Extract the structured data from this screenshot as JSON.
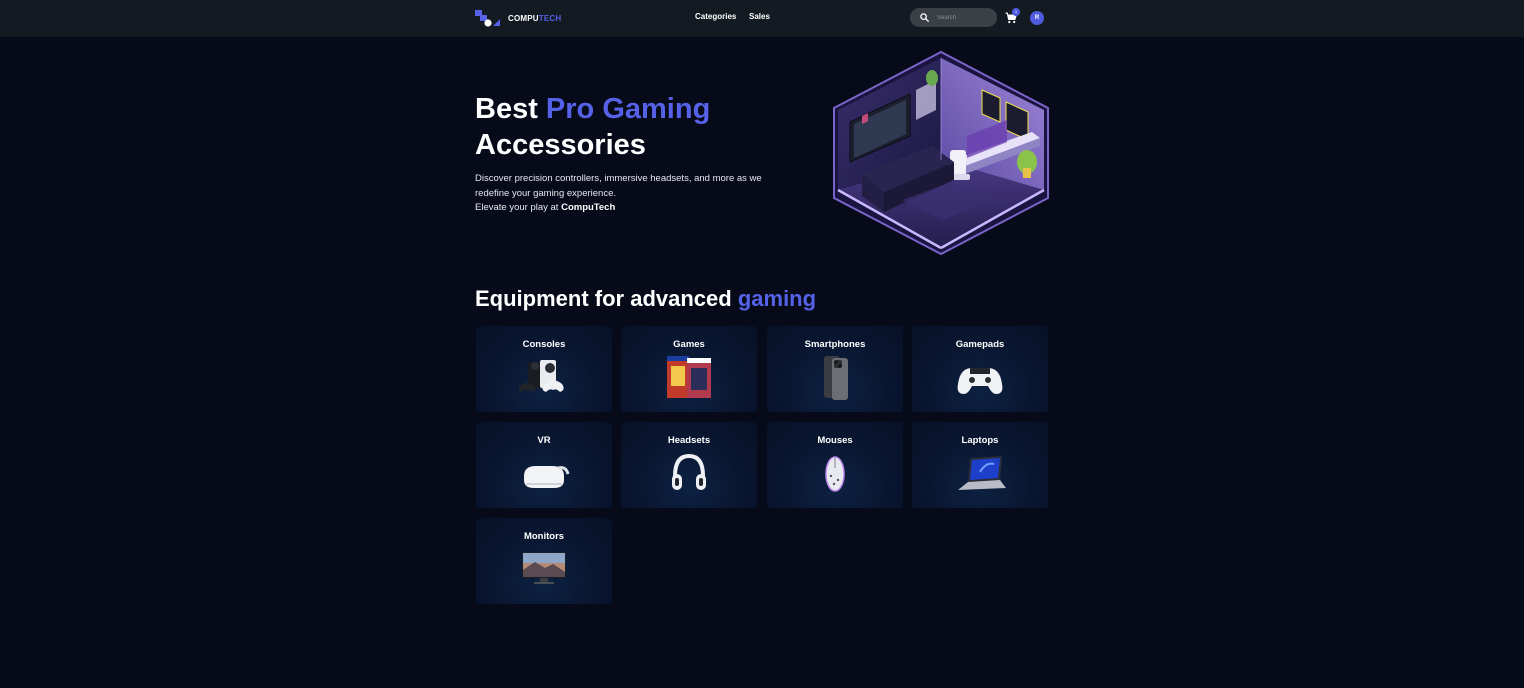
{
  "header": {
    "logo_text_main": "COMPU",
    "logo_text_accent": "TECH",
    "nav": [
      "Categories",
      "Sales"
    ],
    "search_placeholder": "Search",
    "cart_count": "1",
    "avatar_initial": "R"
  },
  "hero": {
    "title_plain": "Best ",
    "title_accent": "Pro Gaming",
    "title_line2": "Accessories",
    "desc_line1": "Discover precision controllers, immersive headsets, and more as we redefine your gaming experience.",
    "desc_line2_prefix": "Elevate your play at ",
    "desc_line2_brand": "CompuTech"
  },
  "equipment": {
    "title_plain": "Equipment for advanced ",
    "title_accent": "gaming",
    "categories": [
      {
        "label": "Consoles",
        "icon": "console-icon"
      },
      {
        "label": "Games",
        "icon": "game-box-icon"
      },
      {
        "label": "Smartphones",
        "icon": "smartphone-icon"
      },
      {
        "label": "Gamepads",
        "icon": "gamepad-icon"
      },
      {
        "label": "VR",
        "icon": "vr-headset-icon"
      },
      {
        "label": "Headsets",
        "icon": "headphones-icon"
      },
      {
        "label": "Mouses",
        "icon": "mouse-icon"
      },
      {
        "label": "Laptops",
        "icon": "laptop-icon"
      },
      {
        "label": "Monitors",
        "icon": "monitor-icon"
      }
    ]
  },
  "colors": {
    "background": "#070a18",
    "navbar": "#141a22",
    "accent": "#5561e6",
    "card": "#0a1834"
  }
}
